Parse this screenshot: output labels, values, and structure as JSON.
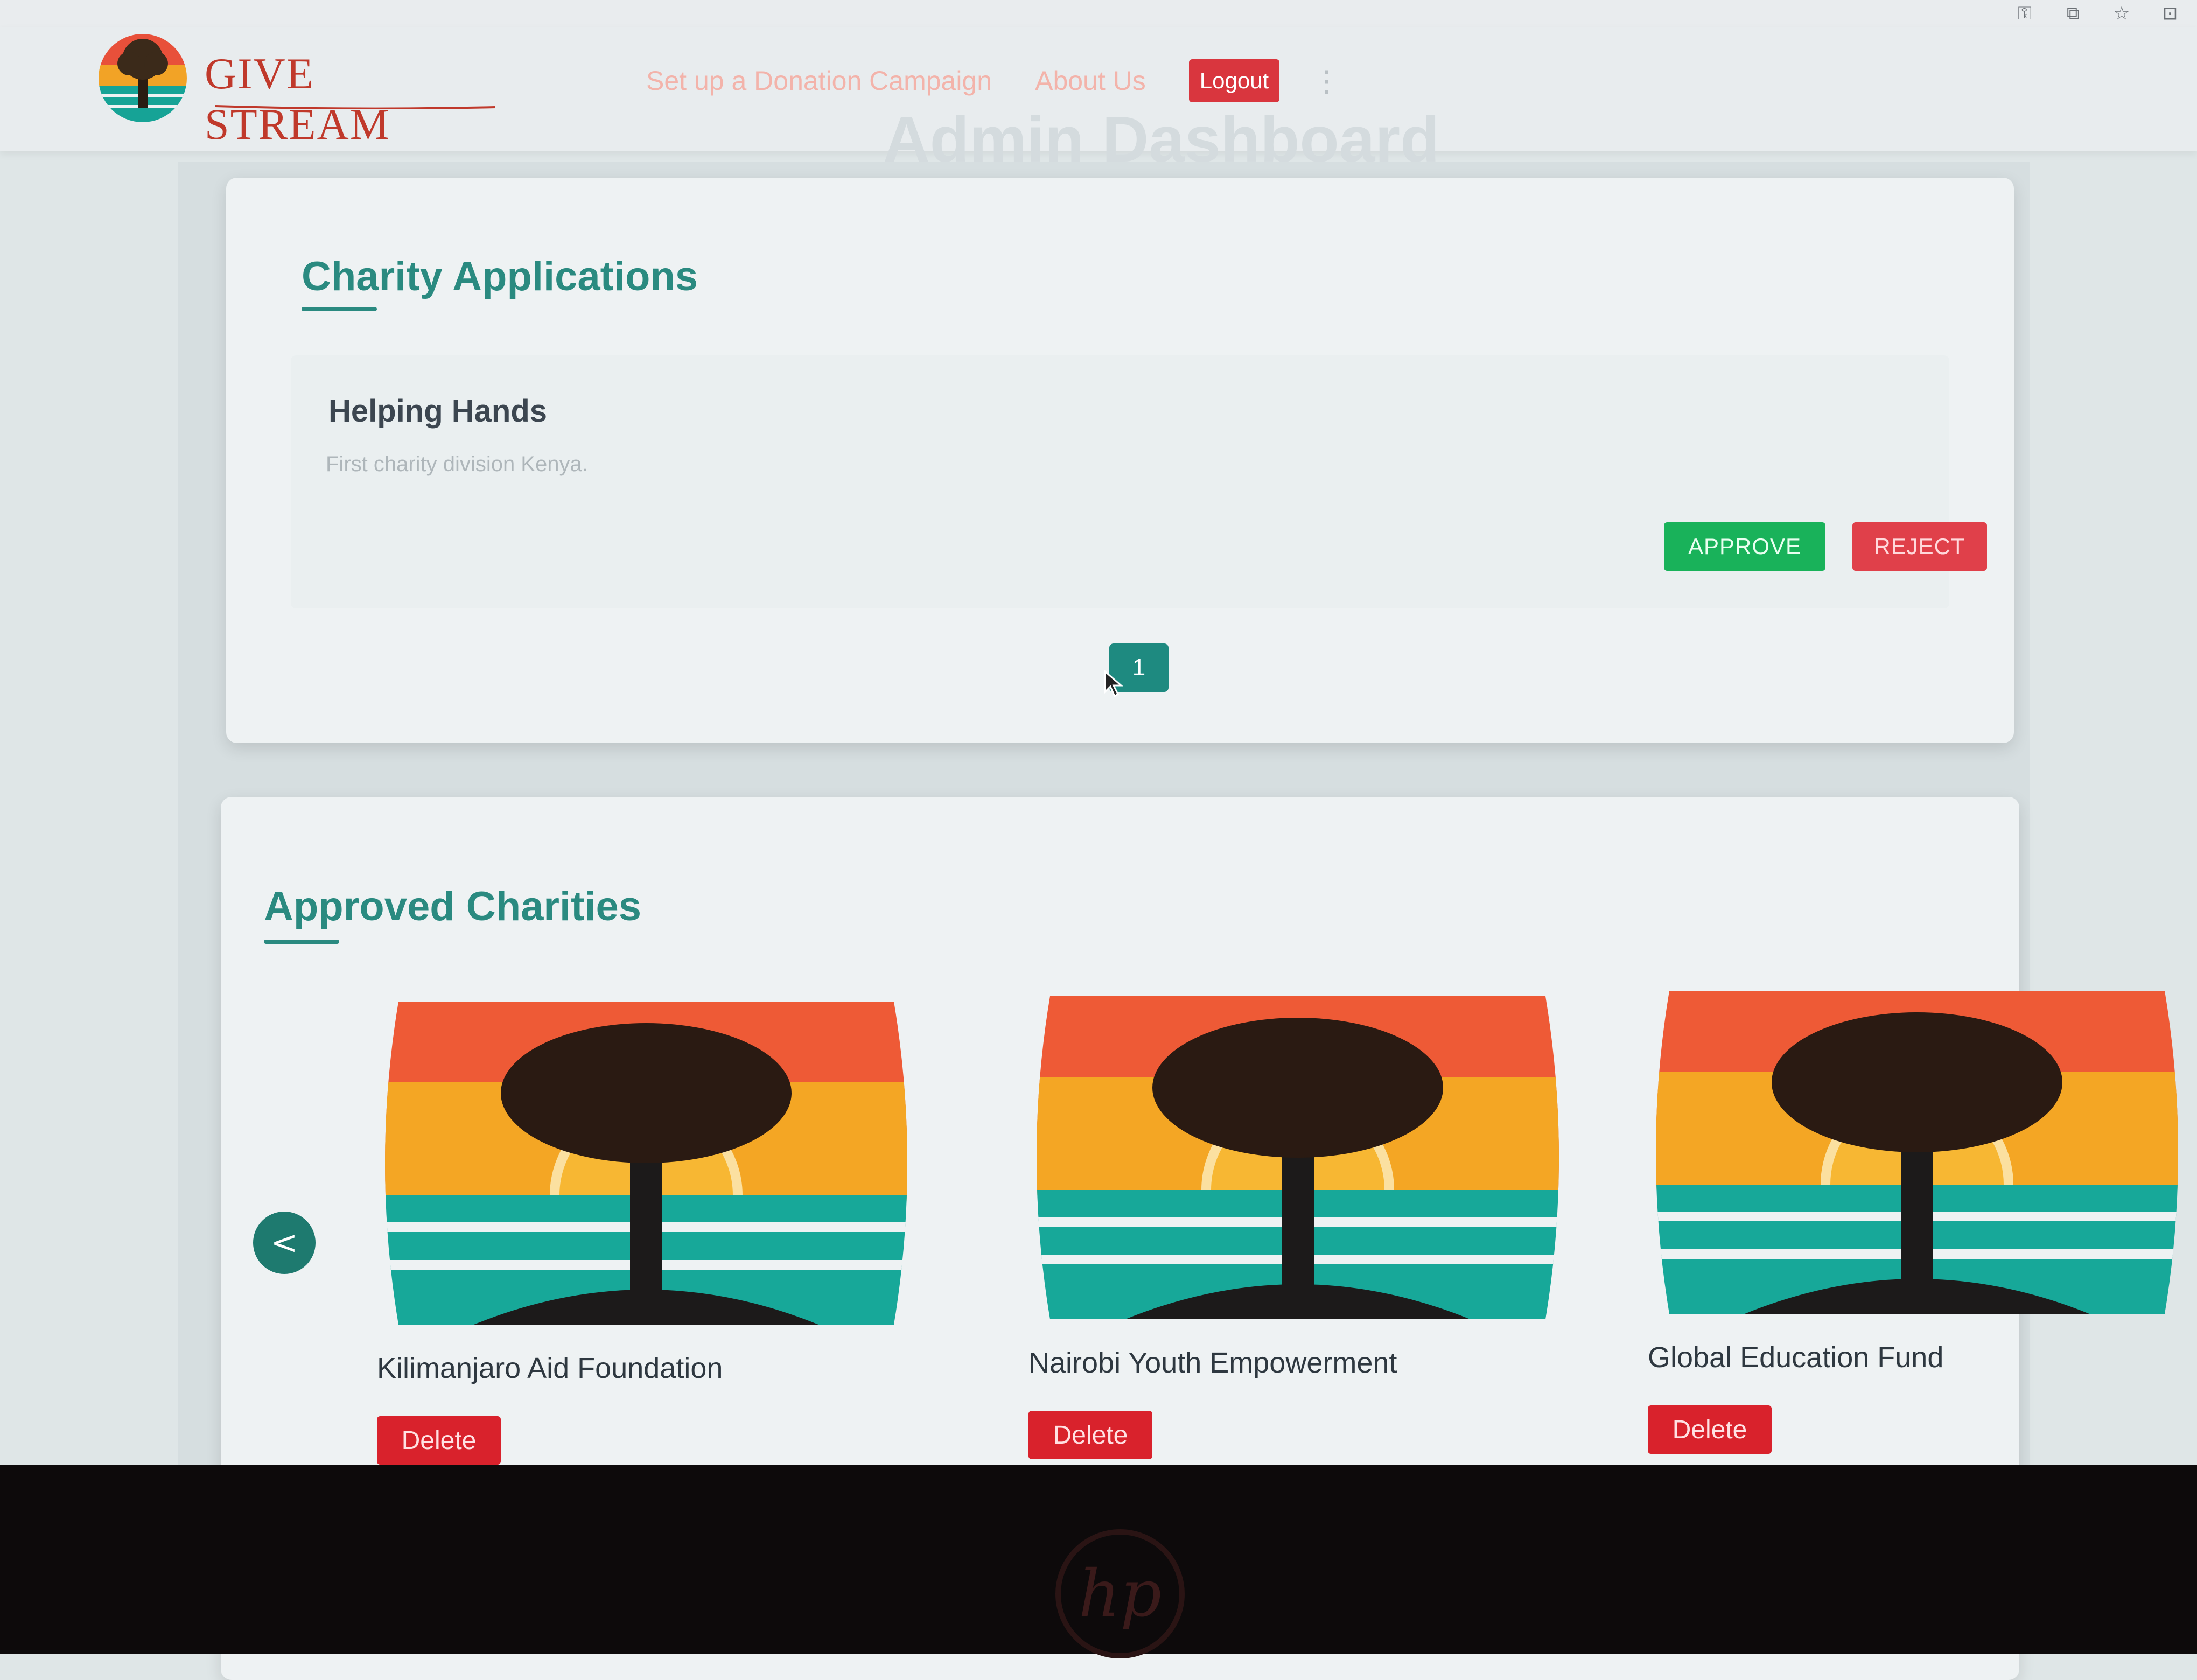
{
  "browser": {
    "icons": [
      "key-icon",
      "install-icon",
      "star-icon",
      "extensions-icon"
    ]
  },
  "header": {
    "brand": "GIVE STREAM",
    "nav": {
      "setup_campaign": "Set up a Donation Campaign",
      "about_us": "About Us",
      "logout": "Logout"
    },
    "ghost_title": "Admin Dashboard"
  },
  "applications": {
    "title": "Charity Applications",
    "items": [
      {
        "name": "Helping Hands",
        "description": "First charity division Kenya.",
        "approve_label": "APPROVE",
        "reject_label": "REJECT"
      }
    ],
    "page": "1"
  },
  "approved": {
    "title": "Approved Charities",
    "prev_label": "<",
    "next_label": ">",
    "items": [
      {
        "name": "Kilimanjaro Aid Foundation",
        "delete_label": "Delete"
      },
      {
        "name": "Nairobi Youth Empowerment",
        "delete_label": "Delete"
      },
      {
        "name": "Global Education Fund",
        "delete_label": "Delete"
      }
    ]
  },
  "colors": {
    "accent": "#2a8a80",
    "approve": "#19b25a",
    "danger": "#d9222c"
  }
}
